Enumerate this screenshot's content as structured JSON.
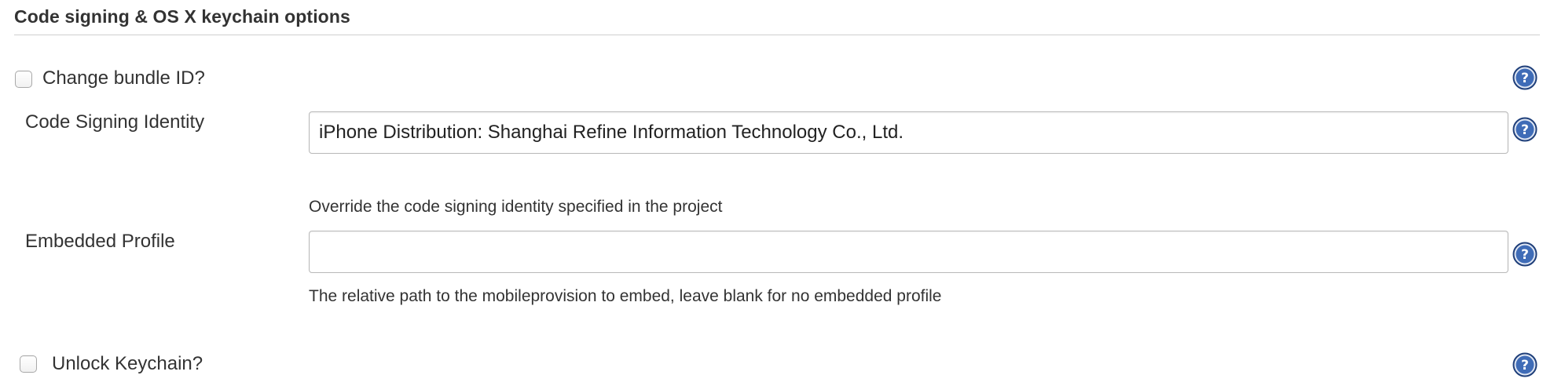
{
  "section": {
    "title": "Code signing & OS X keychain options"
  },
  "change_bundle_id": {
    "label": "Change bundle ID?",
    "checked": false
  },
  "code_signing_identity": {
    "label": "Code Signing Identity",
    "value": "iPhone Distribution: Shanghai Refine Information Technology Co., Ltd.",
    "help": "Override the code signing identity specified in the project"
  },
  "embedded_profile": {
    "label": "Embedded Profile",
    "value": "",
    "help": "The relative path to the mobileprovision to embed, leave blank for no embedded profile"
  },
  "unlock_keychain": {
    "label": "Unlock Keychain?",
    "checked": false
  },
  "icons": {
    "help": "question-mark-help-icon"
  },
  "colors": {
    "help_icon_fill": "#3f6cb7",
    "help_icon_ring": "#1f3f7a",
    "text": "#333333",
    "input_border": "#b8b8b8",
    "rule": "#cfcfcf"
  }
}
